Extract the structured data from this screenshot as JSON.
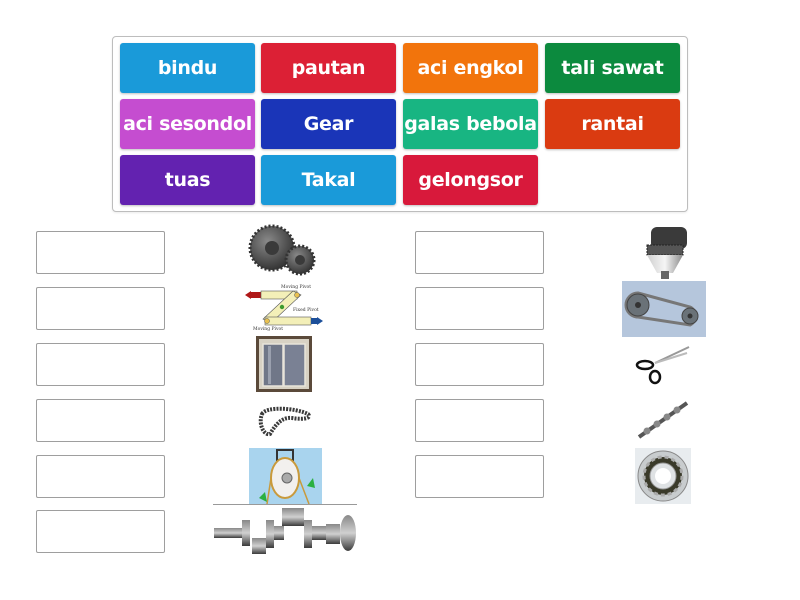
{
  "tiles": [
    {
      "label": "bindu",
      "color": "#1a9ad9"
    },
    {
      "label": "pautan",
      "color": "#dc2035"
    },
    {
      "label": "aci engkol",
      "color": "#f2740c"
    },
    {
      "label": "tali sawat",
      "color": "#0c8a3e"
    },
    {
      "label": "aci sesondol",
      "color": "#c54dd0"
    },
    {
      "label": "Gear",
      "color": "#1a35b8"
    },
    {
      "label": "galas bebola",
      "color": "#18b582"
    },
    {
      "label": "rantai",
      "color": "#da3b11"
    },
    {
      "label": "tuas",
      "color": "#6322b0"
    },
    {
      "label": "Takal",
      "color": "#1a9ad9"
    },
    {
      "label": "gelongsor",
      "color": "#d8193b"
    }
  ],
  "images": {
    "gear": "gears-image",
    "linkage": {
      "labels": [
        "Moving Pivot",
        "Fixed Pivot",
        "Moving Pivot"
      ]
    },
    "sliding_window": "sliding-window-image",
    "chain": "chain-image",
    "pulley": "pulley-image",
    "crankshaft": "crankshaft-image",
    "drill_chuck": "drill-chuck-image",
    "belt_drive": "belt-drive-image",
    "scissors": "scissors-image",
    "camshaft": "camshaft-image",
    "ball_bearing": "ball-bearing-image"
  }
}
